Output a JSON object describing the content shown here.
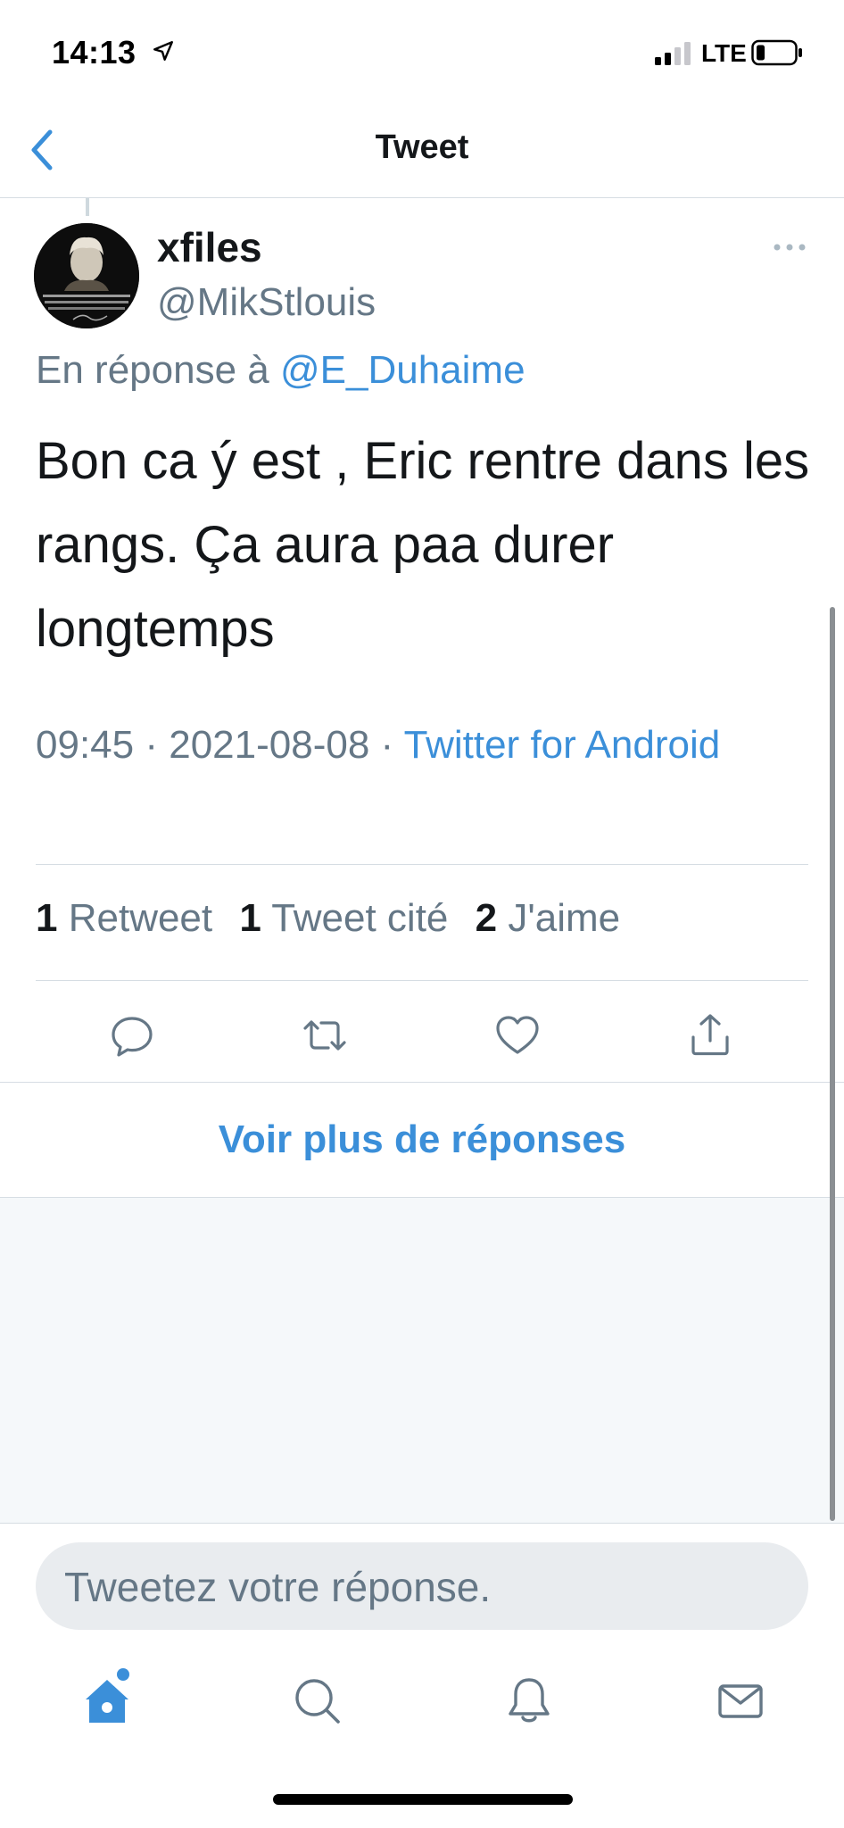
{
  "status_bar": {
    "time": "14:13",
    "network": "LTE"
  },
  "nav": {
    "title": "Tweet"
  },
  "tweet": {
    "author_name": "xfiles",
    "author_handle": "@MikStlouis",
    "reply_prefix": "En réponse à",
    "reply_mention": "@E_Duhaime",
    "text": "Bon ca ý est , Eric rentre dans les rangs. Ça aura paa durer longtemps",
    "time": "09:45",
    "date": "2021-08-08",
    "separator": "·",
    "source": "Twitter for Android",
    "stats": {
      "retweets_count": "1",
      "retweets_label": "Retweet",
      "quotes_count": "1",
      "quotes_label": "Tweet cité",
      "likes_count": "2",
      "likes_label": "J'aime"
    }
  },
  "more_replies_label": "Voir plus de réponses",
  "reply_input": {
    "placeholder": "Tweetez votre réponse."
  },
  "bottom_tabs": [
    "home-icon",
    "search-icon",
    "bell-icon",
    "mail-icon"
  ],
  "colors": {
    "accent": "#3b8fd9",
    "text": "#14171a",
    "secondary": "#657786"
  }
}
